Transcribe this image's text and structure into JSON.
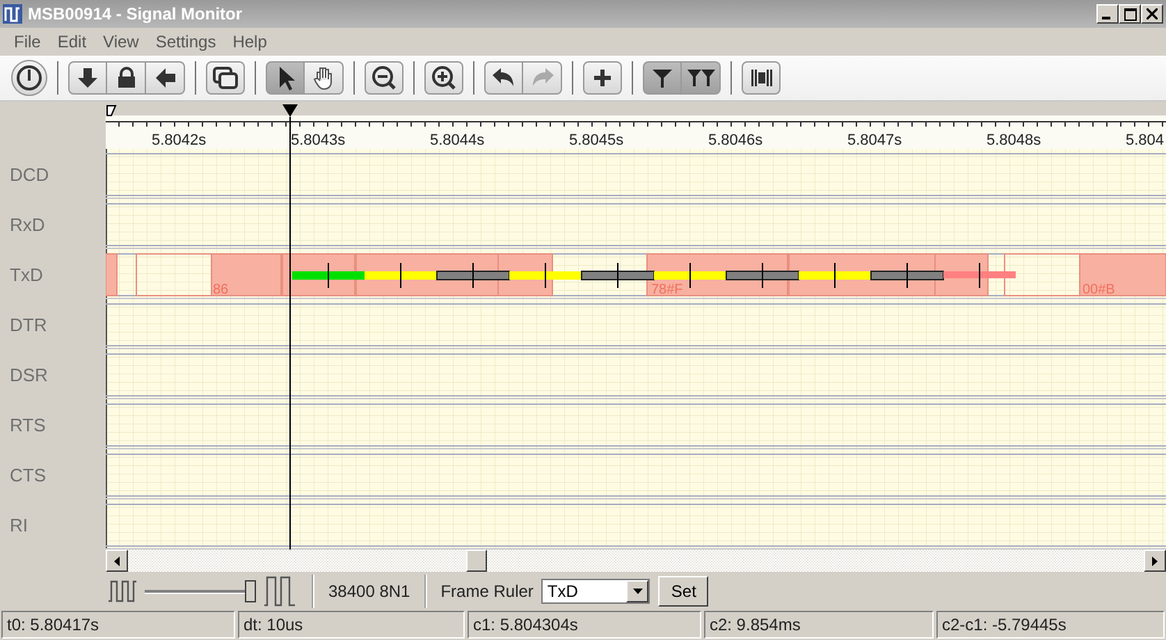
{
  "window": {
    "title": "MSB00914 - Signal Monitor"
  },
  "menu": [
    "File",
    "Edit",
    "View",
    "Settings",
    "Help"
  ],
  "toolbar": [
    [
      {
        "kind": "power",
        "pressed": false
      }
    ],
    [
      {
        "kind": "down",
        "pressed": false
      },
      {
        "kind": "lock",
        "pressed": false
      },
      {
        "kind": "left",
        "pressed": false
      }
    ],
    [
      {
        "kind": "windows",
        "pressed": false
      }
    ],
    [
      {
        "kind": "pointer",
        "pressed": true
      },
      {
        "kind": "hand",
        "pressed": false
      }
    ],
    [
      {
        "kind": "zoom-out",
        "pressed": false
      }
    ],
    [
      {
        "kind": "zoom-in",
        "pressed": false
      }
    ],
    [
      {
        "kind": "undo",
        "pressed": false
      },
      {
        "kind": "redo",
        "pressed": false
      }
    ],
    [
      {
        "kind": "plus",
        "pressed": false
      }
    ],
    [
      {
        "kind": "filter",
        "pressed": true
      },
      {
        "kind": "filter2",
        "pressed": true
      }
    ],
    [
      {
        "kind": "barcode",
        "pressed": false
      }
    ]
  ],
  "ruler": {
    "labels": [
      "5.8042s",
      "5.8043s",
      "5.8044s",
      "5.8045s",
      "5.8046s",
      "5.8047s",
      "5.8048s",
      "5.804"
    ]
  },
  "channels": [
    {
      "name": "DCD"
    },
    {
      "name": "RxD"
    },
    {
      "name": "TxD"
    },
    {
      "name": "DTR"
    },
    {
      "name": "DSR"
    },
    {
      "name": "RTS"
    },
    {
      "name": "CTS"
    },
    {
      "name": "RI"
    }
  ],
  "txd_frames": [
    {
      "label": "86"
    },
    {
      "label": "78#F"
    },
    {
      "label": "00#B"
    }
  ],
  "bits": [
    {
      "color": "#00e000"
    },
    {
      "color": "#ffff00"
    },
    {
      "color": "#808080"
    },
    {
      "color": "#ffff00"
    },
    {
      "color": "#808080"
    },
    {
      "color": "#ffff00"
    },
    {
      "color": "#808080"
    },
    {
      "color": "#ffff00"
    },
    {
      "color": "#808080"
    },
    {
      "color": "#ff8080"
    }
  ],
  "zoom_slider": {
    "level": 0.95
  },
  "line_settings": "38400 8N1",
  "frame_ruler": {
    "label": "Frame Ruler",
    "value": "TxD",
    "button": "Set"
  },
  "status_bar": [
    "t0: 5.80417s",
    "dt: 10us",
    "c1: 5.804304s",
    "c2: 9.854ms",
    "c2-c1: -5.79445s"
  ]
}
